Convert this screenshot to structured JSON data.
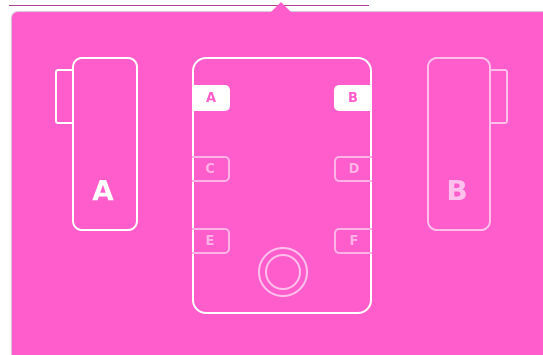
{
  "colors": {
    "panel_background": "#ff5ccc",
    "outline_active": "#ffffff",
    "outline_inactive": "#ffc1ec"
  },
  "devices": {
    "left": {
      "label": "A",
      "state": "active"
    },
    "right": {
      "label": "B",
      "state": "inactive"
    }
  },
  "receiver": {
    "slots": [
      {
        "label": "A",
        "state": "active"
      },
      {
        "label": "B",
        "state": "active"
      },
      {
        "label": "C",
        "state": "inactive"
      },
      {
        "label": "D",
        "state": "inactive"
      },
      {
        "label": "E",
        "state": "inactive"
      },
      {
        "label": "F",
        "state": "inactive"
      }
    ],
    "knob_icon": "dial-knob-icon"
  }
}
